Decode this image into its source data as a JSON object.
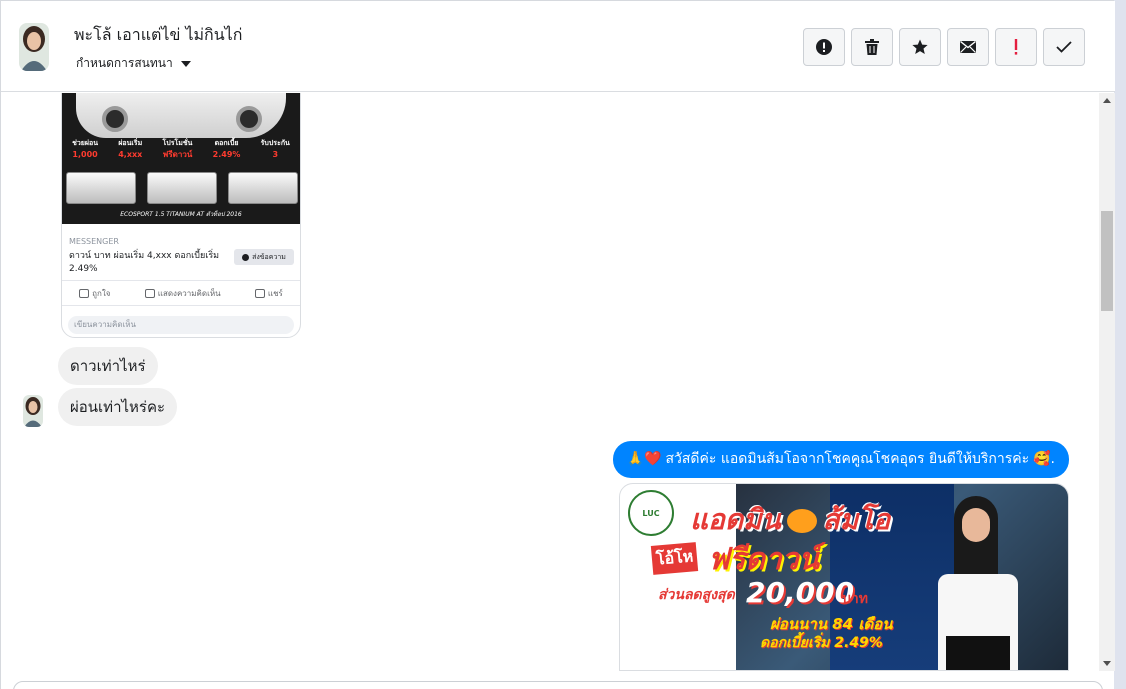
{
  "header": {
    "contact_name": "พะโล้ เอาแต่ไข่ ไม่กินไก่",
    "assign_label": "กำหนดการสนทนา",
    "actions": [
      {
        "name": "report-spam-button",
        "icon": "alert-circle-icon"
      },
      {
        "name": "delete-button",
        "icon": "trash-icon"
      },
      {
        "name": "star-button",
        "icon": "star-icon"
      },
      {
        "name": "mark-unread-button",
        "icon": "envelope-icon"
      },
      {
        "name": "follow-up-button",
        "icon": "exclamation-icon"
      },
      {
        "name": "mark-done-button",
        "icon": "check-icon"
      }
    ]
  },
  "shared_post": {
    "promo_labels": [
      "ช่วยผ่อน",
      "ผ่อนเริ่ม",
      "โปรโมชั่น",
      "ดอกเบี้ย",
      "รับประกัน"
    ],
    "promo_values": [
      "1,000",
      "4,xxx",
      "ฟรีดาวน์",
      "2.49%",
      "3"
    ],
    "caption": "ECOSPORT 1.5 TITANIUM AT ตัวท็อป 2016",
    "source": "MESSENGER",
    "text": "ดาวน์ บาท ผ่อนเริ่ม 4,xxx ดอกเบี้ยเริ่ม 2.49%",
    "send_label": "ส่งข้อความ",
    "like_label": "ถูกใจ",
    "comment_label": "แสดงความคิดเห็น",
    "share_label": "แชร์",
    "comment_placeholder": "เขียนความคิดเห็น"
  },
  "messages": {
    "incoming": [
      {
        "text": "ดาวเท่าไหร่"
      },
      {
        "text": "ผ่อนเท่าไหร่คะ"
      }
    ],
    "outgoing": {
      "emoji_prefix": "🙏❤️",
      "text": "สวัสดีค่ะ แอดมินส้มโอจากโชคคูณโชคอุดร ยินดีให้บริการค่ะ",
      "emoji_suffix": "🥰."
    }
  },
  "promo_image": {
    "logo_text": "LUC",
    "title_left": "แอดมิน",
    "title_right": "ส้มโอ",
    "free_tag": "โอ้โห",
    "free_text": "ฟรีดาวน์",
    "discount_label": "ส่วนลดสูงสุด",
    "discount_amount": "20,000",
    "discount_unit": "บาท",
    "installment": "ผ่อนนาน 84 เดือน",
    "interest": "ดอกเบี้ยเริ่ม 2.49%"
  },
  "colors": {
    "accent": "#0084ff",
    "incoming_bubble": "#f0f0f0",
    "follow_up": "#e41e3f"
  }
}
